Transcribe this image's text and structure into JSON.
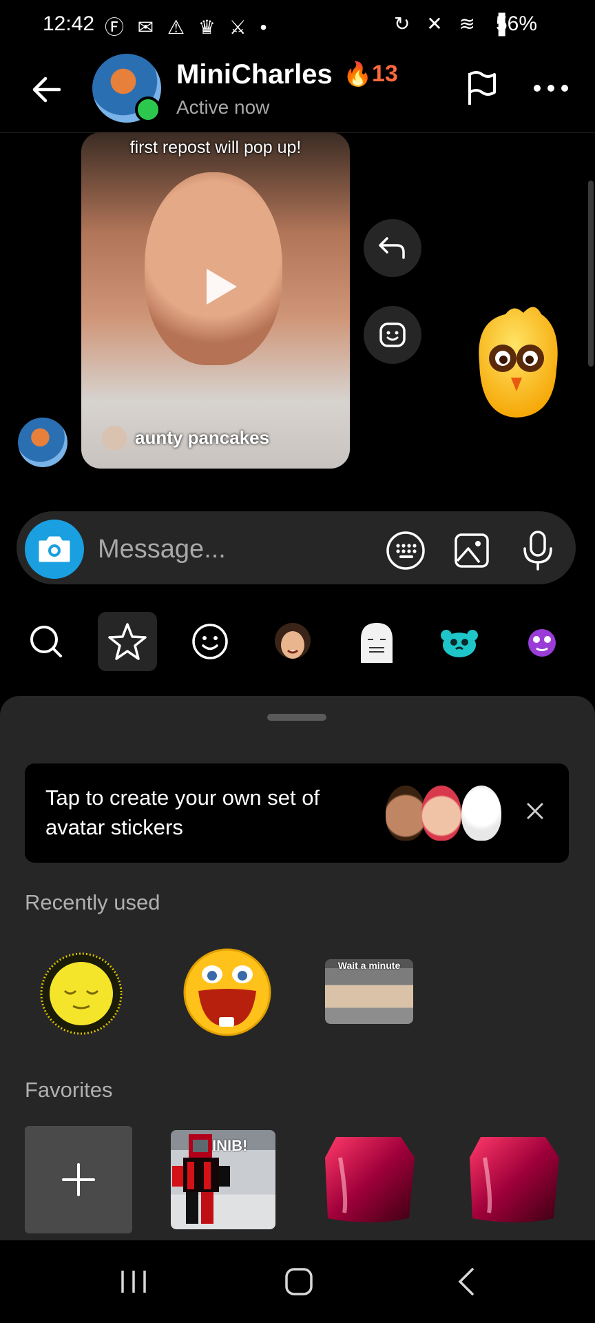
{
  "status_bar": {
    "time": "12:42",
    "left_icons": "Ⓕ ✉ ⚠ ♛ ⚔ •",
    "right_icons": "↻ ✕ ≋ ▐",
    "battery": "56%"
  },
  "header": {
    "title": "MiniCharles",
    "streak_emoji": "🔥",
    "streak_count": "13",
    "subtitle": "Active now"
  },
  "chat": {
    "video_caption": "first repost will pop up!",
    "video_username": "aunty pancakes"
  },
  "composer": {
    "placeholder": "Message..."
  },
  "sticker_tabs": [
    {
      "name": "search-icon"
    },
    {
      "name": "star-icon"
    },
    {
      "name": "smiley-icon"
    },
    {
      "name": "avatar-face-icon"
    },
    {
      "name": "ghost-sticker-icon"
    },
    {
      "name": "bear-sticker-icon"
    },
    {
      "name": "purple-face-icon"
    }
  ],
  "sheet": {
    "promo_text": "Tap to create your own set of avatar stickers",
    "recent_title": "Recently used",
    "favorites_title": "Favorites",
    "meme_text_1": "Wait a minute",
    "meme_text_2": "INIB!"
  },
  "colors": {
    "accent_blue": "#1aa0e0",
    "online_green": "#2cc84d",
    "streak_orange": "#ff6a3d",
    "sheet_bg": "#262626"
  }
}
